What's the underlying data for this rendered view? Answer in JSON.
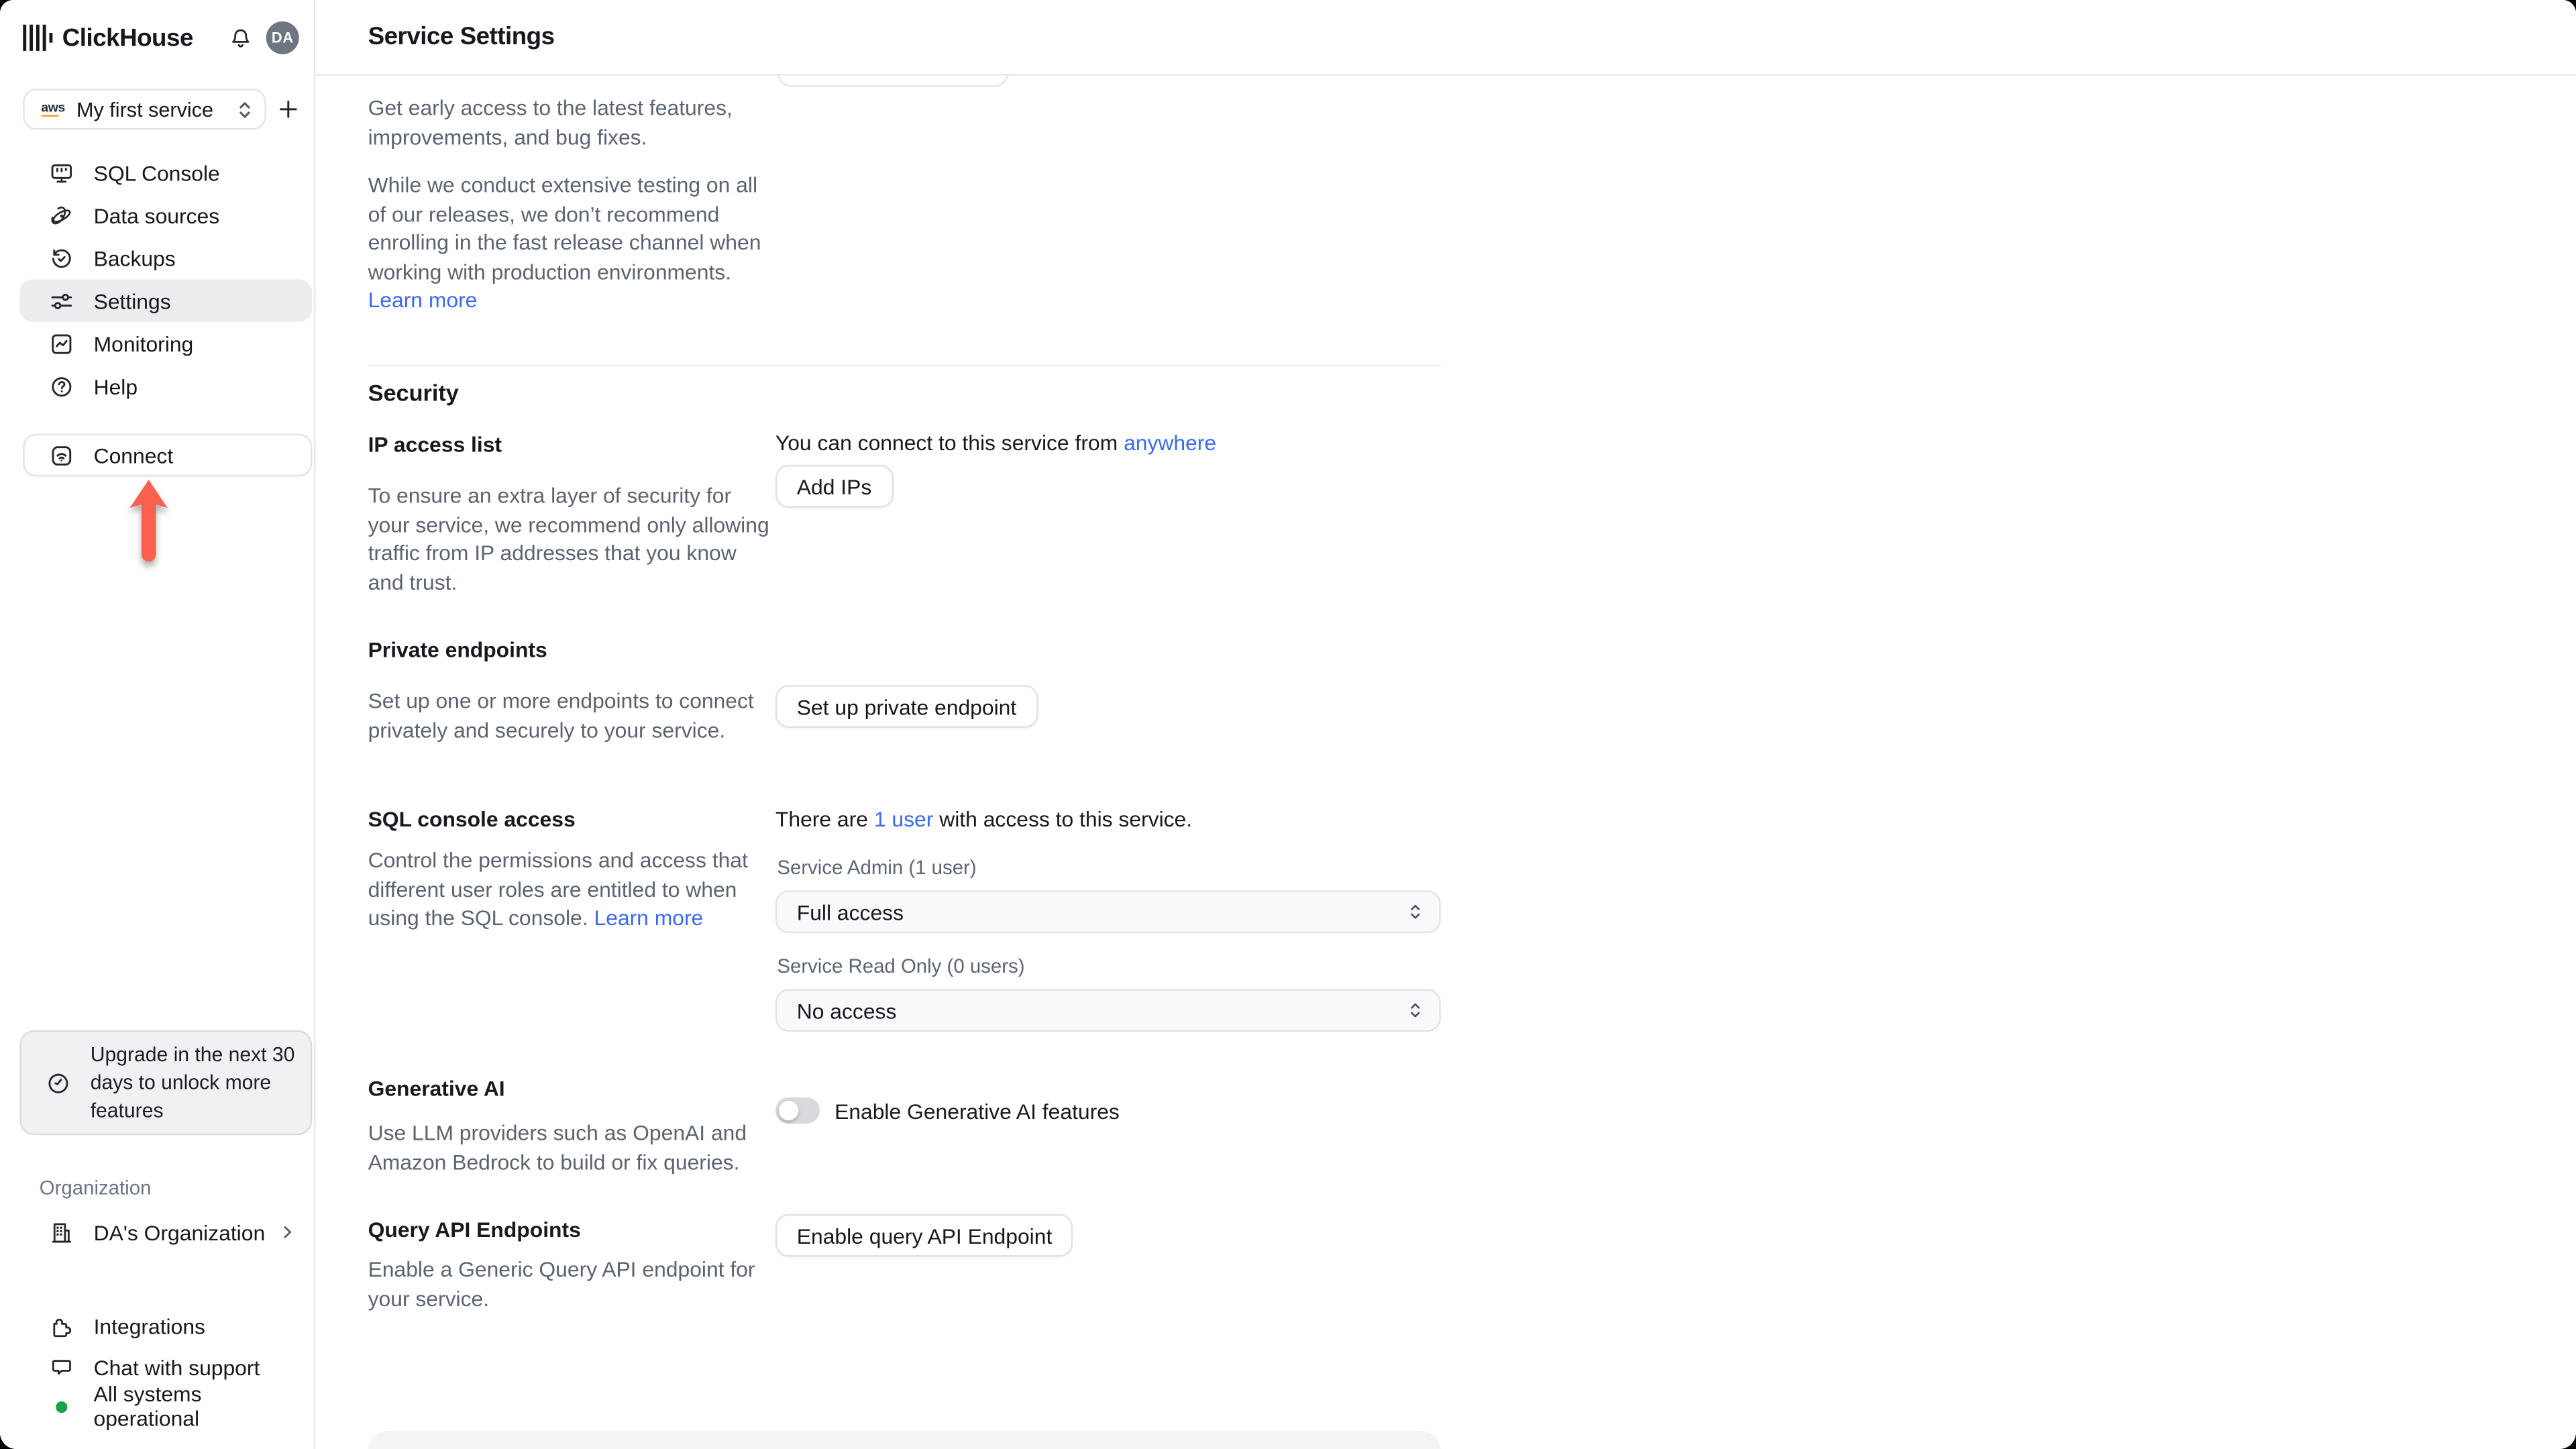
{
  "colors": {
    "link_blue": "#3b6af2",
    "arrow_red": "#f9604e",
    "status_green": "#17a34a",
    "active_nav_bg": "#ededef",
    "toggle_off": "#d9dade",
    "border": "#e7e8ea"
  },
  "brand": {
    "name": "ClickHouse",
    "avatar_initials": "DA"
  },
  "sidebar": {
    "service_selector": {
      "provider": "aws",
      "selected": "My first service"
    },
    "nav": [
      {
        "label": "SQL Console"
      },
      {
        "label": "Data sources"
      },
      {
        "label": "Backups"
      },
      {
        "label": "Settings"
      },
      {
        "label": "Monitoring"
      },
      {
        "label": "Help"
      }
    ],
    "connect": {
      "label": "Connect"
    },
    "upgrade_notice": {
      "text": "Upgrade in the next 30 days to unlock more features"
    },
    "organization": {
      "section_label": "Organization",
      "name": "DA's Organization"
    },
    "footer": {
      "integrations": "Integrations",
      "chat": "Chat with support",
      "status": "All systems operational"
    }
  },
  "header": {
    "title": "Service Settings"
  },
  "release_channel": {
    "para1": "Get early access to the latest features, improvements, and bug fixes.",
    "para2": "While we conduct extensive testing on all of our releases, we don’t recommend enrolling in the fast release channel when working with production environments.",
    "learn_more": "Learn more"
  },
  "security": {
    "heading": "Security",
    "ip_access_list": {
      "title": "IP access list",
      "description": "To ensure an extra layer of security for your service, we recommend only allowing traffic from IP addresses that you know and trust.",
      "connect_text": "You can connect to this service from",
      "connect_link": "anywhere",
      "add_ips_button": "Add IPs"
    },
    "private_endpoints": {
      "title": "Private endpoints",
      "description": "Set up one or more endpoints to connect privately and securely to your service.",
      "setup_button": "Set up private endpoint"
    },
    "sql_console_access": {
      "title": "SQL console access",
      "description": "Control the permissions and access that different user roles are entitled to when using the SQL console.",
      "learn_more": "Learn more",
      "users_prefix": "There are",
      "users_link": "1 user",
      "users_suffix": "with access to this service.",
      "service_admin_label": "Service Admin (1 user)",
      "service_admin_value": "Full access",
      "service_read_only_label": "Service Read Only (0 users)",
      "service_read_only_value": "No access"
    },
    "generative_ai": {
      "title": "Generative AI",
      "description": "Use LLM providers such as OpenAI and Amazon Bedrock to build or fix queries.",
      "toggle_label": "Enable Generative AI features"
    },
    "query_api_endpoints": {
      "title": "Query API Endpoints",
      "description": "Enable a Generic Query API endpoint for your service.",
      "enable_button": "Enable query API Endpoint"
    }
  }
}
